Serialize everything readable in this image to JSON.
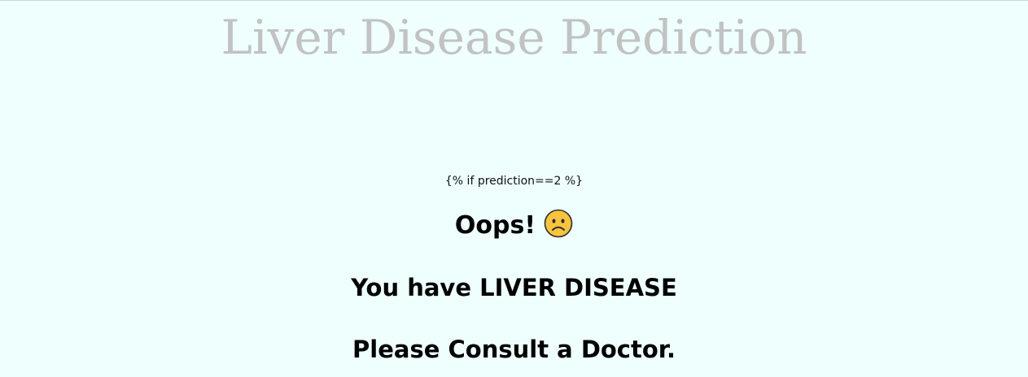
{
  "page": {
    "title": "Liver Disease Prediction",
    "template_condition": "{% if prediction==2 %}"
  },
  "result": {
    "exclamation": "Oops!",
    "icon": "sad-face-icon",
    "message": "You have LIVER DISEASE",
    "advice": "Please Consult a Doctor."
  },
  "colors": {
    "background": "#eefffe",
    "title": "#c2c2c2",
    "emoji_face": "#f6c43d"
  }
}
